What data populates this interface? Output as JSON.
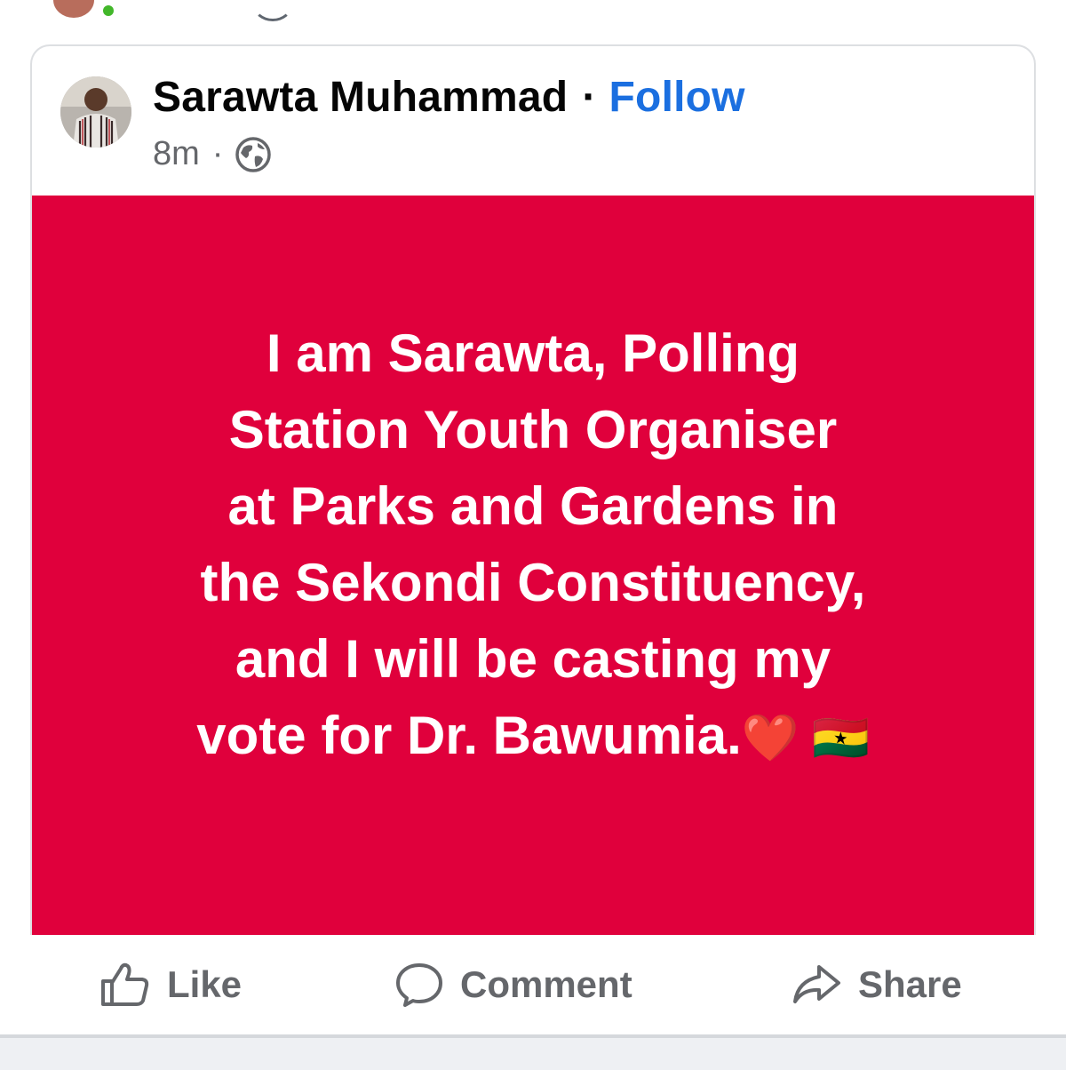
{
  "post": {
    "author_name": "Sarawta Muhammad",
    "dot_separator": "·",
    "follow_label": "Follow",
    "timestamp": "8m",
    "meta_separator": "·",
    "privacy_icon": "globe-icon",
    "body_lines": [
      "I am Sarawta, Polling",
      "Station Youth Organiser",
      "at Parks and Gardens in",
      "the Sekondi Constituency,",
      "and I will be casting my",
      "vote for Dr. Bawumia."
    ],
    "body_emojis": "❤️ 🇬🇭",
    "background_color": "#e0003c"
  },
  "actions": {
    "like_label": "Like",
    "comment_label": "Comment",
    "share_label": "Share",
    "like_icon": "thumbs-up-icon",
    "comment_icon": "speech-bubble-icon",
    "share_icon": "share-arrow-icon"
  },
  "colors": {
    "follow": "#1b6fe0",
    "muted_text": "#65676b",
    "post_background": "#e0003c"
  }
}
